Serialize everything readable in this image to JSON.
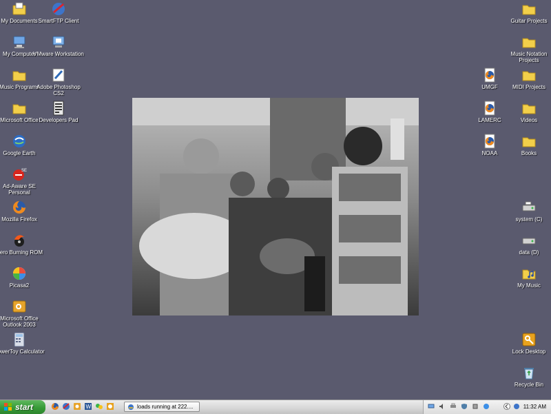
{
  "desktop": {
    "left_icons": [
      {
        "label": "My Documents",
        "icon": "my-documents-icon"
      },
      {
        "label": "SmartFTP Client",
        "icon": "smartftp-icon"
      },
      {
        "label": "My Computer",
        "icon": "my-computer-icon"
      },
      {
        "label": "VMware Workstation",
        "icon": "vmware-icon"
      },
      {
        "label": "Music Programs",
        "icon": "folder-icon"
      },
      {
        "label": "Adobe Photoshop CS2",
        "icon": "photoshop-icon"
      },
      {
        "label": "Microsoft Office",
        "icon": "folder-icon"
      },
      {
        "label": "Developers Pad",
        "icon": "developers-pad-icon"
      },
      {
        "label": "Google Earth",
        "icon": "google-earth-icon"
      },
      {
        "label": "Ad-Aware SE Personal",
        "icon": "ad-aware-icon"
      },
      {
        "label": "Mozilla Firefox",
        "icon": "firefox-icon"
      },
      {
        "label": "Nero Burning ROM",
        "icon": "nero-icon"
      },
      {
        "label": "Picasa2",
        "icon": "picasa-icon"
      },
      {
        "label": "Microsoft Office Outlook 2003",
        "icon": "outlook-icon"
      },
      {
        "label": "PowerToy Calculator",
        "icon": "calculator-icon"
      }
    ],
    "right_icons": [
      {
        "label": "Guitar Projects",
        "icon": "folder-icon"
      },
      {
        "label": "Music Notation Projects",
        "icon": "folder-icon"
      },
      {
        "label": "UMGF",
        "icon": "firefox-doc-icon"
      },
      {
        "label": "MIDI Projects",
        "icon": "folder-icon"
      },
      {
        "label": "LAMERC",
        "icon": "firefox-doc-icon"
      },
      {
        "label": "Videos",
        "icon": "folder-icon"
      },
      {
        "label": "NOAA",
        "icon": "firefox-doc-icon"
      },
      {
        "label": "Books",
        "icon": "folder-icon"
      },
      {
        "label": "system (C)",
        "icon": "hard-drive-icon"
      },
      {
        "label": "data (D)",
        "icon": "hard-drive-icon"
      },
      {
        "label": "My Music",
        "icon": "my-music-icon"
      },
      {
        "label": "Lock Desktop",
        "icon": "lock-desktop-icon"
      },
      {
        "label": "Recycle Bin",
        "icon": "recycle-bin-icon"
      }
    ]
  },
  "wallpaper": {
    "description_icon": "wallpaper-photo"
  },
  "taskbar": {
    "start_label": "start",
    "quick_launch": [
      "firefox-icon",
      "smartftp-icon",
      "outlook-icon",
      "word-icon",
      "msn-icon",
      "picasa-icon"
    ],
    "task_button_label": "loads running at 222....",
    "tray_icons": [
      "network-icon",
      "speaker-icon",
      "printer-icon",
      "shield-icon",
      "usb-icon",
      "messenger-icon"
    ],
    "clock": "11:32 AM"
  },
  "colors": {
    "desktop_bg": "#5a5a6e",
    "start_green": "#379b37",
    "folder_yellow": "#f2cf4a"
  }
}
